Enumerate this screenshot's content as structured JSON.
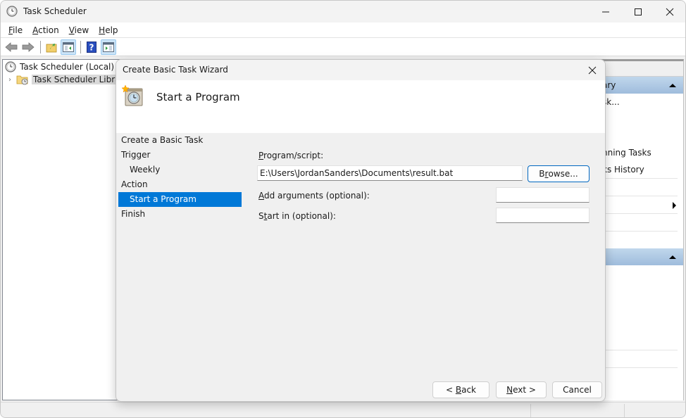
{
  "window": {
    "title": "Task Scheduler",
    "icon": "clock-icon",
    "controls": [
      "minimize-icon",
      "maximize-icon",
      "close-icon"
    ]
  },
  "menubar": {
    "items": [
      {
        "label": "File",
        "accel": "F",
        "rest": "ile"
      },
      {
        "label": "Action",
        "accel": "A",
        "rest": "ction"
      },
      {
        "label": "View",
        "accel": "V",
        "rest": "iew"
      },
      {
        "label": "Help",
        "accel": "H",
        "rest": "elp"
      }
    ]
  },
  "toolbar": {
    "buttons": [
      "back-arrow-icon",
      "forward-arrow-icon",
      "up-folder-icon",
      "show-hide-console-tree-icon",
      "help-icon",
      "show-hide-action-pane-icon"
    ]
  },
  "tree": {
    "root": "Task Scheduler (Local)",
    "library": "Task Scheduler Library"
  },
  "actions_pane": {
    "section1_title": "ary",
    "items": [
      "sk...",
      "",
      "",
      "nning Tasks",
      "ks History"
    ],
    "section2_title": ""
  },
  "wizard": {
    "title": "Create Basic Task Wizard",
    "header_title": "Start a Program",
    "steps": [
      {
        "label": "Create a Basic Task",
        "sub": false,
        "selected": false
      },
      {
        "label": "Trigger",
        "sub": false,
        "selected": false
      },
      {
        "label": "Weekly",
        "sub": true,
        "selected": false
      },
      {
        "label": "Action",
        "sub": false,
        "selected": false
      },
      {
        "label": "Start a Program",
        "sub": true,
        "selected": true
      },
      {
        "label": "Finish",
        "sub": false,
        "selected": false
      }
    ],
    "program_label": {
      "accel": "P",
      "rest": "rogram/script:"
    },
    "program_value": "E:\\Users\\JordanSanders\\Documents\\result.bat",
    "browse_label": {
      "pre": "B",
      "accel": "r",
      "rest": "owse..."
    },
    "args_label": {
      "accel": "A",
      "rest": "dd arguments (optional):"
    },
    "args_value": "",
    "startin_label": {
      "pre": "S",
      "accel": "t",
      "rest": "art in (optional):"
    },
    "startin_value": "",
    "back_label": {
      "pre": "< ",
      "accel": "B",
      "rest": "ack"
    },
    "next_label": {
      "pre": "",
      "accel": "N",
      "rest": "ext >"
    },
    "cancel_label": "Cancel"
  },
  "colors": {
    "selection": "#0078d7",
    "default_button_border": "#0067c0",
    "actions_header": "#b5cde6"
  }
}
